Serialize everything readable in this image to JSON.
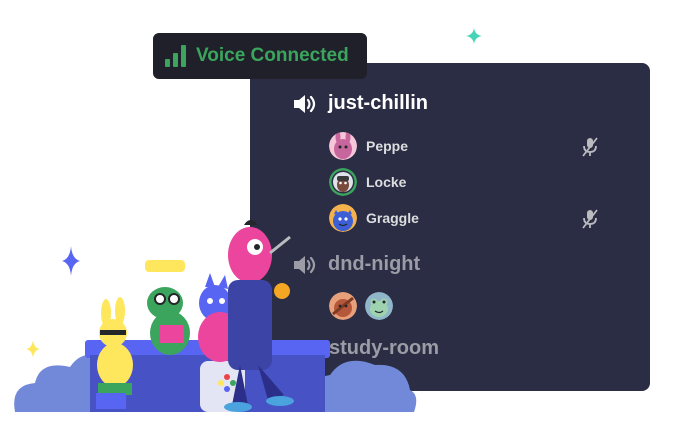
{
  "status": {
    "label": "Voice Connected",
    "color": "#3ba55d",
    "icon": "signal-bars-icon"
  },
  "channels": [
    {
      "name": "just-chillin",
      "icon": "speaker-icon",
      "active": true,
      "users": [
        {
          "name": "Peppe",
          "muted": true,
          "avatar": "pink-creature-avatar"
        },
        {
          "name": "Locke",
          "muted": false,
          "avatar": "green-ring-avatar"
        },
        {
          "name": "Graggle",
          "muted": true,
          "avatar": "blue-creature-avatar"
        }
      ]
    },
    {
      "name": "dnd-night",
      "icon": "speaker-icon",
      "active": false,
      "avatars": [
        "orange-creature-avatar",
        "frog-avatar"
      ]
    },
    {
      "name": "study-room",
      "active": false
    }
  ],
  "colors": {
    "panel": "#2b2d44",
    "badge_bg": "#1f2029",
    "active_text": "#ffffff",
    "inactive_text": "#9b9ca6",
    "user_text": "#dcddde",
    "sparkle_teal": "#45d4b6",
    "sparkle_blue": "#5865f2",
    "sparkle_yellow": "#fee75c"
  },
  "illustration": {
    "name": "discord-characters-illustration"
  }
}
